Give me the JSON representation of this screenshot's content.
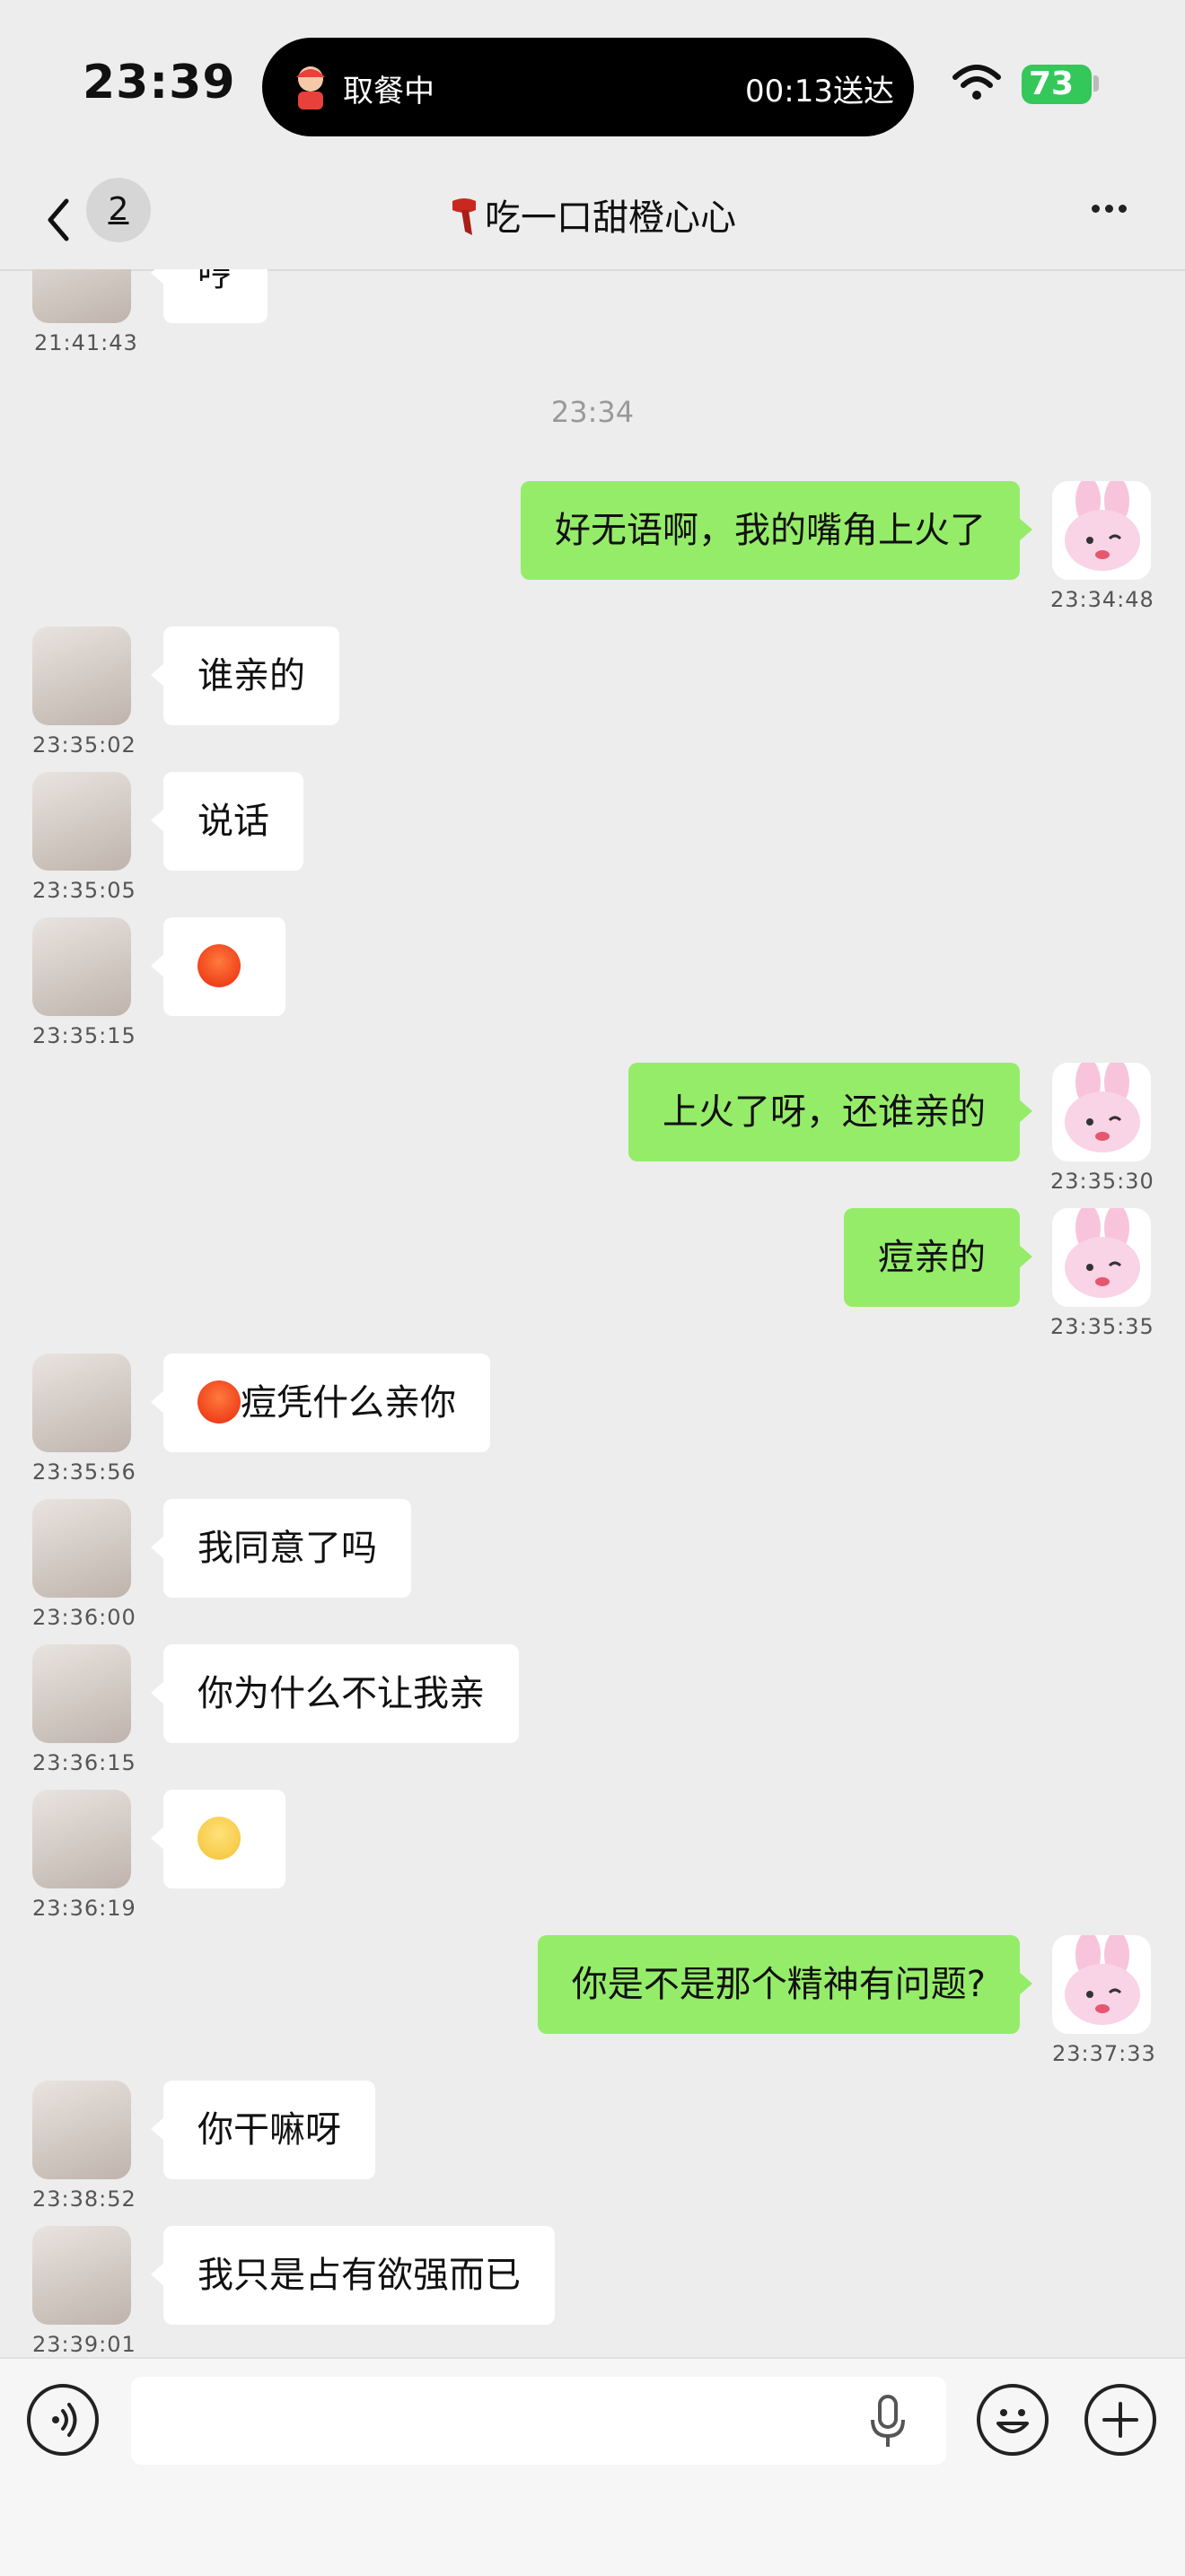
{
  "status_bar": {
    "time": "23:39",
    "island_label": "取餐中",
    "island_eta": "00:13送达",
    "battery": "73"
  },
  "nav": {
    "unread_count": "2",
    "title": "吃一口甜橙心心"
  },
  "chat": {
    "partial_top": {
      "text": "哼",
      "time": "21:41:43"
    },
    "center_time": "23:34",
    "messages": [
      {
        "side": "out",
        "text": "好无语啊，我的嘴角上火了",
        "time": "23:34:48"
      },
      {
        "side": "in",
        "text": "谁亲的",
        "time": "23:35:02"
      },
      {
        "side": "in",
        "text": "",
        "emoji": "angry-face-emoji",
        "time": "23:35:05",
        "text_label": "说话"
      },
      {
        "side": "in",
        "text": "",
        "emoji": "angry-face-emoji",
        "time": "23:35:15"
      },
      {
        "side": "out",
        "text": "上火了呀，还谁亲的",
        "time": "23:35:30"
      },
      {
        "side": "out",
        "text": "痘亲的",
        "time": "23:35:35"
      },
      {
        "side": "in",
        "text": "痘凭什么亲你",
        "emoji": "angry-face-emoji",
        "time": "23:35:56"
      },
      {
        "side": "in",
        "text": "我同意了吗",
        "time": "23:36:00"
      },
      {
        "side": "in",
        "text": "你为什么不让我亲",
        "time": "23:36:15"
      },
      {
        "side": "in",
        "text": "",
        "emoji": "anxious-sweat-emoji",
        "time": "23:36:19"
      },
      {
        "side": "out",
        "text": "你是不是那个精神有问题?",
        "time": "23:37:33"
      },
      {
        "side": "in",
        "text": "你干嘛呀",
        "time": "23:38:52"
      },
      {
        "side": "in",
        "text": "我只是占有欲强而已",
        "time": "23:39:01"
      }
    ]
  },
  "input": {
    "placeholder": ""
  },
  "colors": {
    "outgoing_bubble": "#95ec69",
    "incoming_bubble": "#ffffff",
    "background": "#ededed",
    "battery": "#34c759"
  }
}
